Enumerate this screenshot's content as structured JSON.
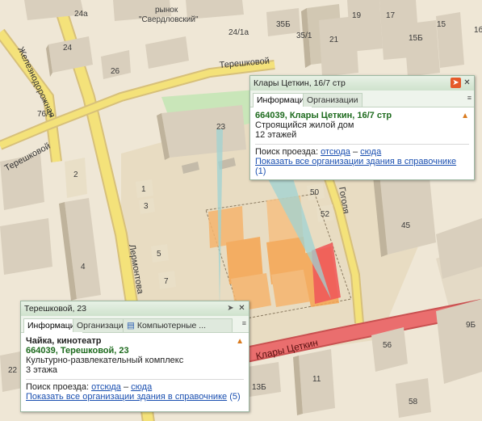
{
  "map_labels": {
    "market": "рынок",
    "market_name": "\"Свердловский\"",
    "b24a": "24а",
    "b24": "24",
    "b24_1a": "24/1а",
    "b35b": "35Б",
    "b35_1": "35/1",
    "b19": "19",
    "b17": "17",
    "b15b": "15Б",
    "b15": "15",
    "b21": "21",
    "b26": "26",
    "b76_1": "76/1",
    "b23": "23",
    "b2": "2",
    "b1": "1",
    "b3": "3",
    "b4": "4",
    "b5": "5",
    "b7": "7",
    "b50": "50",
    "b52": "52",
    "b45": "45",
    "b56": "56",
    "b9b": "9Б",
    "b11": "11",
    "b13b": "13Б",
    "b58": "58",
    "b22": "22",
    "b1b": "1б"
  },
  "streets": {
    "zheleznodorozhnaya": "Железнодорожная",
    "tereshkovoy_top": "Терешковой",
    "tereshkovoy_left": "Терешковой",
    "lermontova": "Лермонтова",
    "gogolya": "Гоголя",
    "klary_cetkin": "Клары Цеткин"
  },
  "popup_top": {
    "title": "Клары Цеткин, 16/7 стр",
    "tab_info": "Информация",
    "tab_orgs": "Организации",
    "address": "664039, Клары Цеткин, 16/7 стр",
    "type": "Строящийся жилой дом",
    "floors": "12 этажей",
    "route_label": "Поиск проезда:",
    "route_from": "отсюда",
    "route_dash": "–",
    "route_to": "сюда",
    "show_all": "Показать все организации здания в справочнике",
    "show_all_count": "(1)"
  },
  "popup_bottom": {
    "title": "Терешковой, 23",
    "tab_info": "Информация",
    "tab_orgs": "Организации",
    "tab_computer": "Компьютерные ...",
    "name": "Чайка, кинотеатр",
    "address": "664039, Терешковой, 23",
    "type": "Культурно-развлекательный комплекс",
    "floors": "3 этажа",
    "route_label": "Поиск проезда:",
    "route_from": "отсюда",
    "route_dash": "–",
    "route_to": "сюда",
    "show_all": "Показать все организации здания в справочнике",
    "show_all_count": "(5)"
  },
  "colors": {
    "ground": "#efe7d6",
    "road_yellow": "#f4e27a",
    "road_red": "#ea6e6e",
    "building": "#d9cfbd",
    "building_side": "#bfb39c",
    "highlight_orange": "#f5a552",
    "highlight_red": "#ef5a5a",
    "popup_border": "#9fb9a4"
  }
}
